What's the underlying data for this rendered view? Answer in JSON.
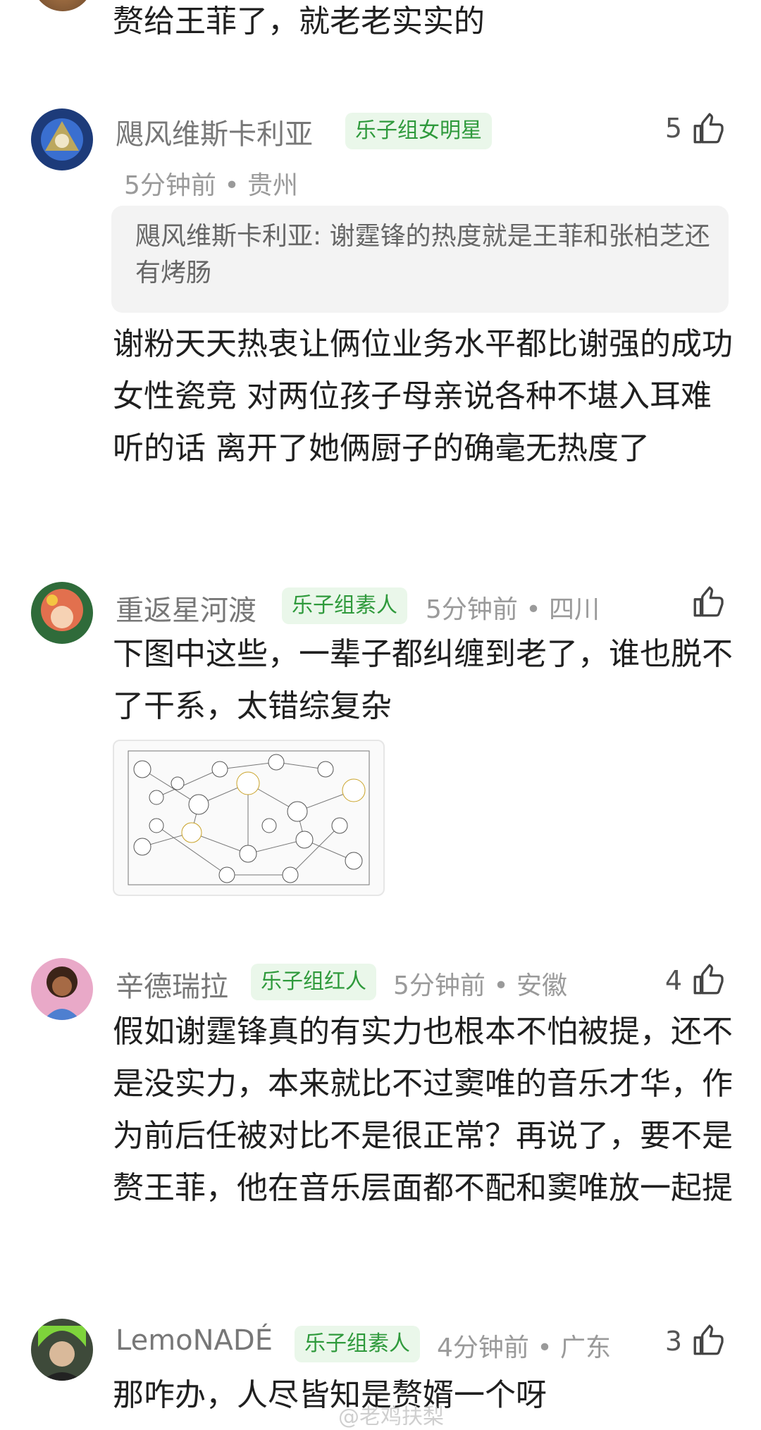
{
  "top": {
    "text": "赘给王菲了，就老老实实的"
  },
  "comments": [
    {
      "username": "飓风维斯卡利亚",
      "badge": "乐子组女明星",
      "time_location": "5分钟前 • 贵州",
      "likes": "5",
      "avatar_icon": "avatar-image",
      "quote": "飓风维斯卡利亚: 谢霆锋的热度就是王菲和张柏芝还有烤肠",
      "text": "谢粉天天热衷让俩位业务水平都比谢强的成功女性瓷竞 对两位孩子母亲说各种不堪入耳难听的话 离开了她俩厨子的确毫无热度了"
    },
    {
      "username": "重返星河渡",
      "badge": "乐子组素人",
      "time_location": "5分钟前 • 四川",
      "likes": "",
      "avatar_icon": "avatar-image",
      "text": "下图中这些，一辈子都纠缠到老了，谁也脱不了干系，太错综复杂"
    },
    {
      "username": "辛德瑞拉",
      "badge": "乐子组红人",
      "time_location": "5分钟前 • 安徽",
      "likes": "4",
      "avatar_icon": "avatar-image",
      "text": "假如谢霆锋真的有实力也根本不怕被提，还不是没实力，本来就比不过窦唯的音乐才华，作为前后任被对比不是很正常？再说了，要不是赘王菲，他在音乐层面都不配和窦唯放一起提"
    },
    {
      "username": "LemoNADÉ",
      "badge": "乐子组素人",
      "time_location": "4分钟前 • 广东",
      "likes": "3",
      "avatar_icon": "avatar-image",
      "text": "那咋办，人尽皆知是赘婿一个呀"
    }
  ],
  "watermark": "@老鸡扶梨",
  "colors": {
    "badge_green": "#2f9a3c",
    "badge_bg": "#eaf7ea",
    "quote_bg": "#f3f3f3"
  },
  "icons": {
    "like": "thumbs-up-icon"
  }
}
